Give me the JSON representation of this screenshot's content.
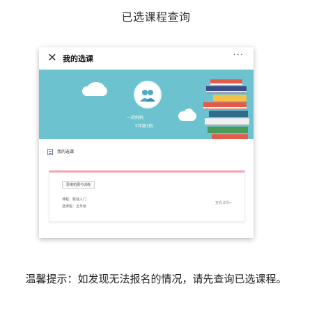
{
  "page_title": "已选课程查询",
  "app": {
    "navbar": {
      "close_glyph": "✕",
      "title": "我的选课",
      "more_glyph": "···"
    },
    "banner": {
      "user_name": "一的妈妈",
      "user_grade": "5年级1班",
      "accent_color": "#6cc3cf"
    },
    "section": {
      "label": "我的选课"
    },
    "course": {
      "tag": "思维拓展与训练",
      "line1": "课程：数独入门",
      "line2": "选课班：五年级",
      "detail_link": "查看详情>",
      "accent_color": "#f4a3b0"
    }
  },
  "notice": "温馨提示：如发现无法报名的情况，请先查询已选课程。"
}
